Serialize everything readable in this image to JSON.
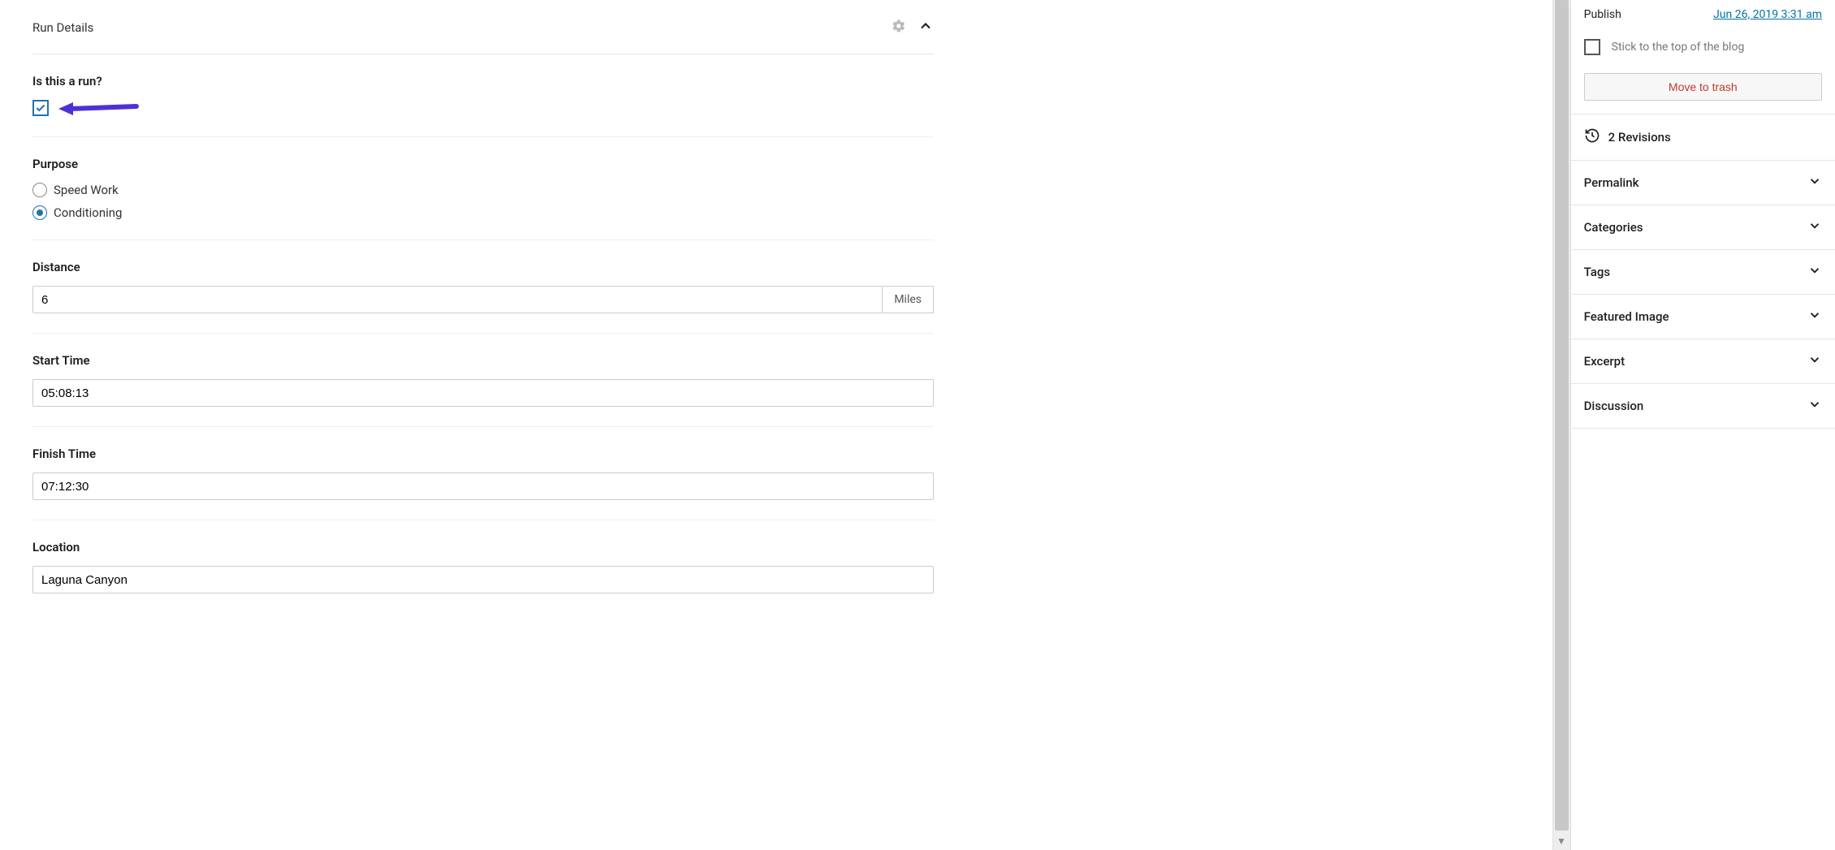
{
  "panel": {
    "title": "Run Details"
  },
  "fields": {
    "is_run": {
      "label": "Is this a run?",
      "checked": true
    },
    "purpose": {
      "label": "Purpose",
      "options": [
        "Speed Work",
        "Conditioning"
      ],
      "selected": "Conditioning"
    },
    "distance": {
      "label": "Distance",
      "value": "6",
      "unit": "Miles"
    },
    "start_time": {
      "label": "Start Time",
      "value": "05:08:13"
    },
    "finish_time": {
      "label": "Finish Time",
      "value": "07:12:30"
    },
    "location": {
      "label": "Location",
      "value": "Laguna Canyon"
    }
  },
  "sidebar": {
    "publish": {
      "label": "Publish",
      "date": "Jun 26, 2019 3:31 am"
    },
    "stick": {
      "label": "Stick to the top of the blog"
    },
    "trash": {
      "label": "Move to trash"
    },
    "revisions": {
      "label": "2 Revisions"
    },
    "panels": {
      "permalink": "Permalink",
      "categories": "Categories",
      "tags": "Tags",
      "featured_image": "Featured Image",
      "excerpt": "Excerpt",
      "discussion": "Discussion"
    }
  }
}
